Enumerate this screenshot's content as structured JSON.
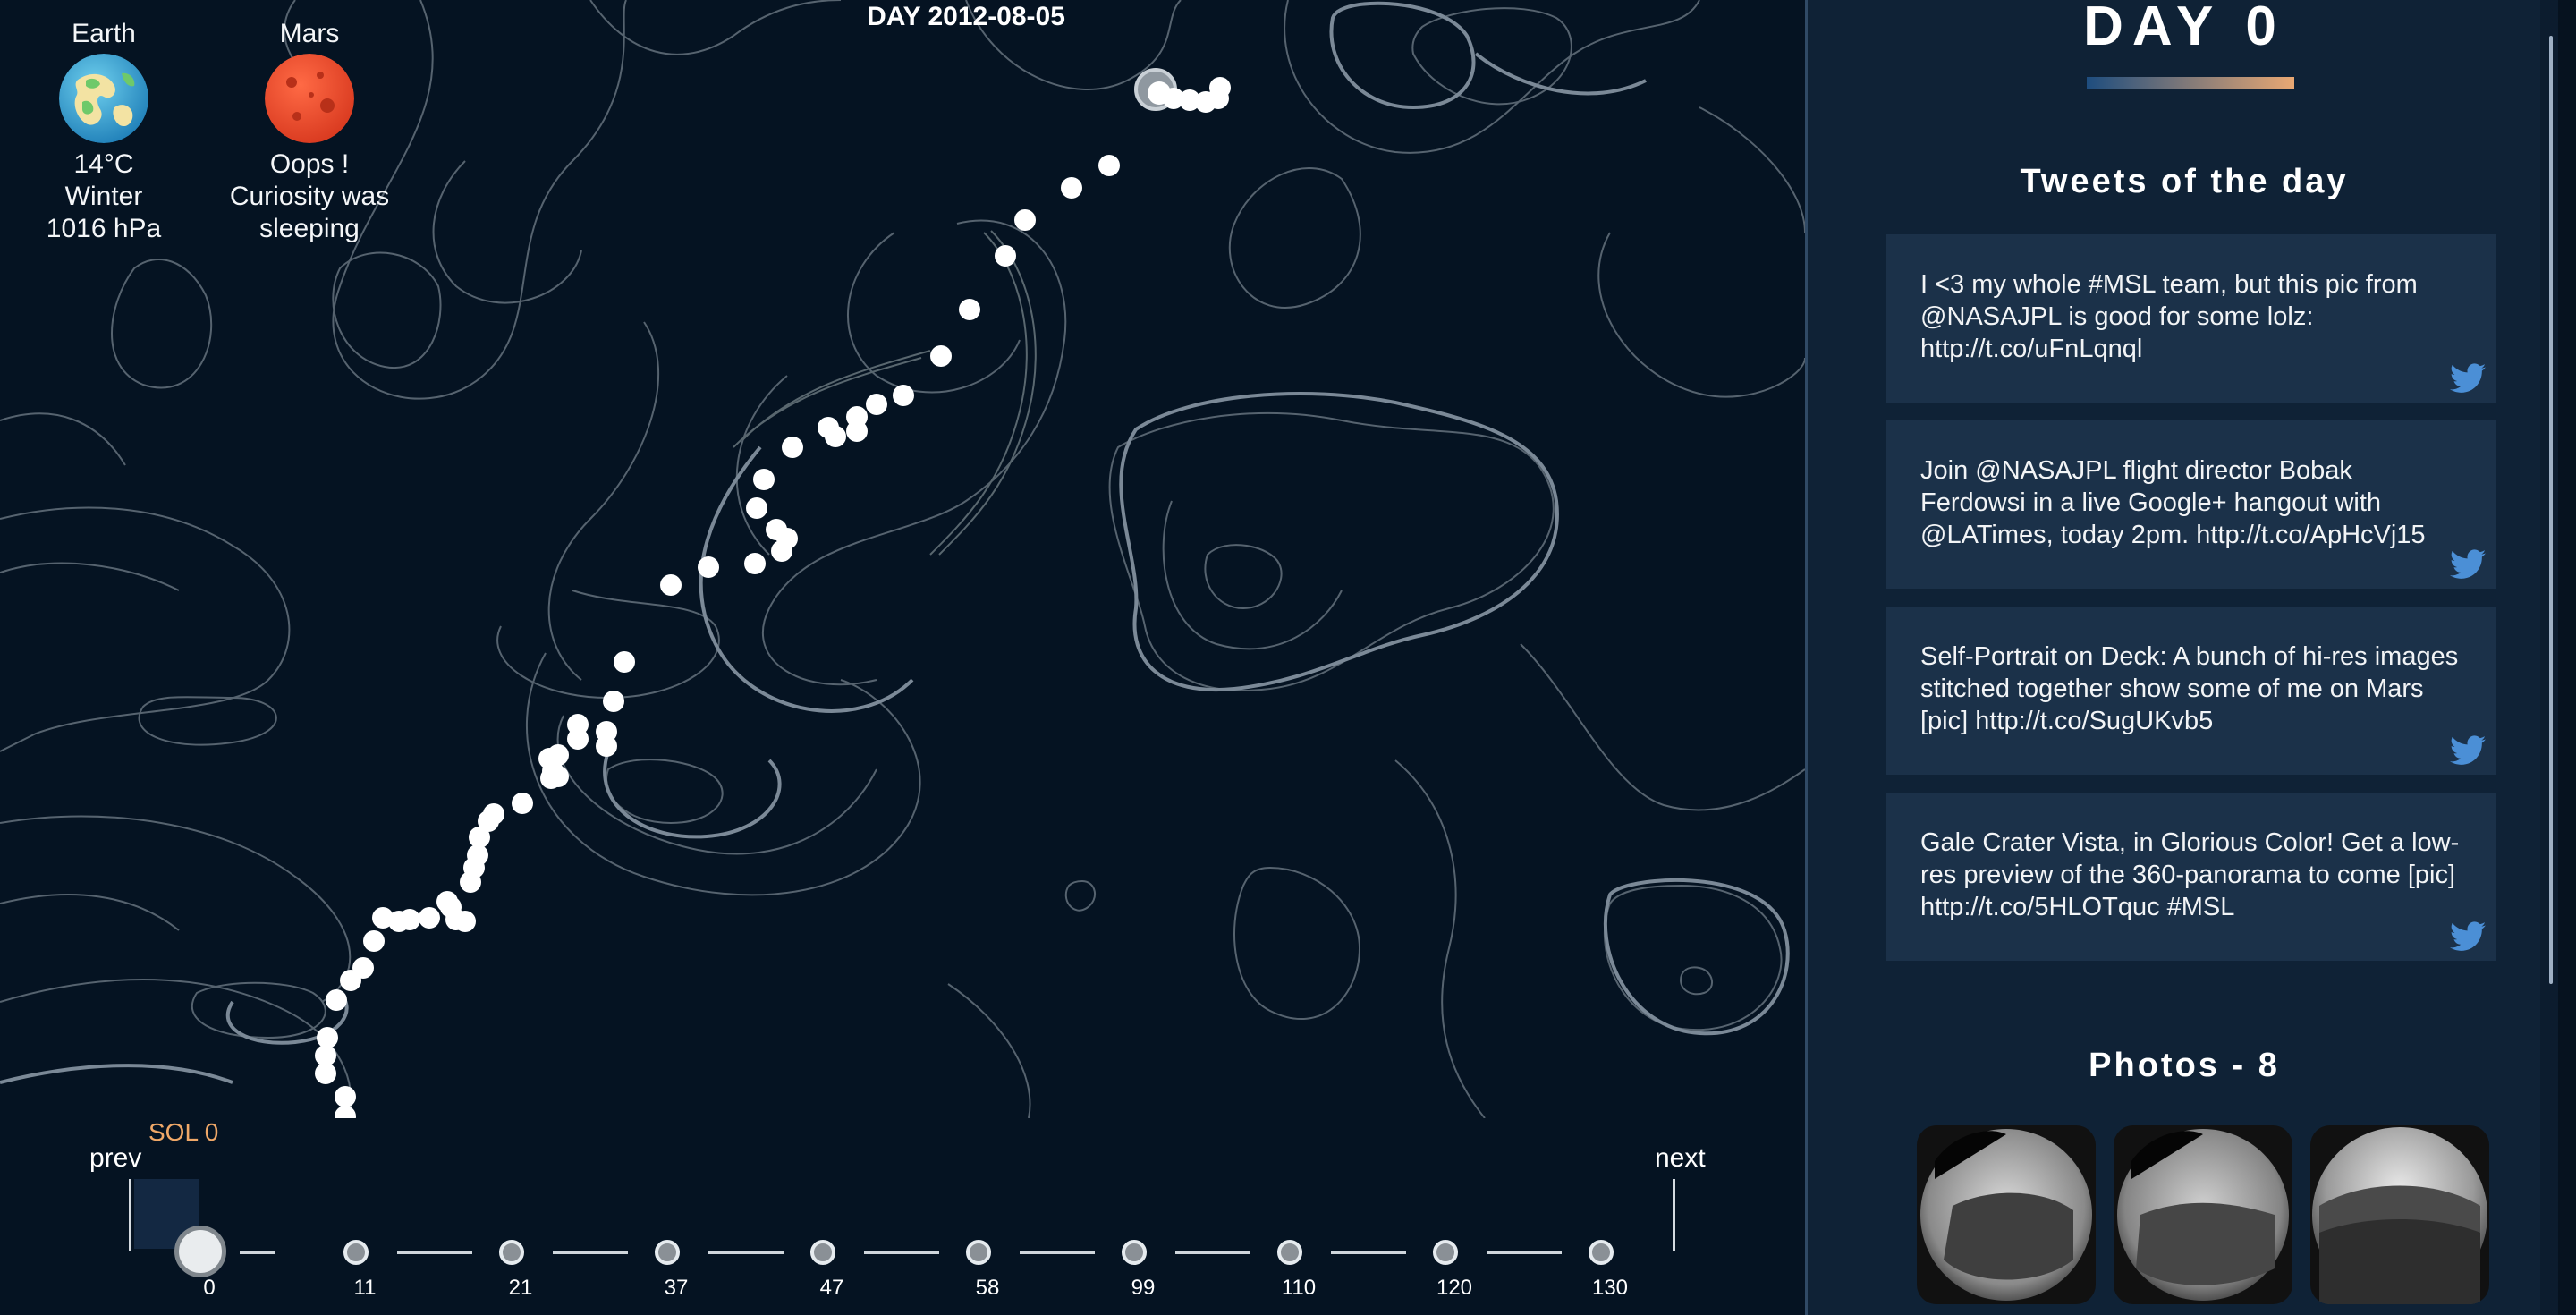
{
  "header": {
    "date_label": "DAY 2012-08-05"
  },
  "earth": {
    "name": "Earth",
    "temperature": "14°C",
    "season": "Winter",
    "pressure": "1016 hPa",
    "icon": "earth-globe-icon"
  },
  "mars": {
    "name": "Mars",
    "line1": "Oops !",
    "line2": "Curiosity was",
    "line3": "sleeping",
    "icon": "mars-globe-icon"
  },
  "timeline": {
    "sol_label": "SOL 0",
    "prev_label": "prev",
    "next_label": "next",
    "sols": [
      "0",
      "11",
      "21",
      "37",
      "47",
      "58",
      "99",
      "110",
      "120",
      "130"
    ],
    "active_index": 0
  },
  "sidebar": {
    "day_title": "DAY 0",
    "tweets_heading": "Tweets of the day",
    "tweets": [
      {
        "text": "I <3 my whole #MSL team, but this pic from @NASAJPL is good for some lolz: http://t.co/uFnLqnql"
      },
      {
        "text": "Join @NASAJPL flight director Bobak Ferdowsi in a live Google+ hangout with @LATimes, today 2pm. http://t.co/ApHcVj15"
      },
      {
        "text": "Self-Portrait on Deck: A bunch of hi-res images stitched together show some of me on Mars [pic] http://t.co/SugUKvb5"
      },
      {
        "text": "Gale Crater Vista, in Glorious Color! Get a low-res preview of the 360-panorama to come [pic] http://t.co/5HLOTquc #MSL"
      }
    ],
    "photos_heading": "Photos - 8",
    "photos": [
      "hazcam-photo-1",
      "hazcam-photo-2",
      "hazcam-photo-3"
    ]
  },
  "colors": {
    "background": "#051322",
    "sidebar": "#0f2236",
    "card": "#1b3149",
    "sol_accent": "#f0a868",
    "contour": "#6f7e8d"
  }
}
